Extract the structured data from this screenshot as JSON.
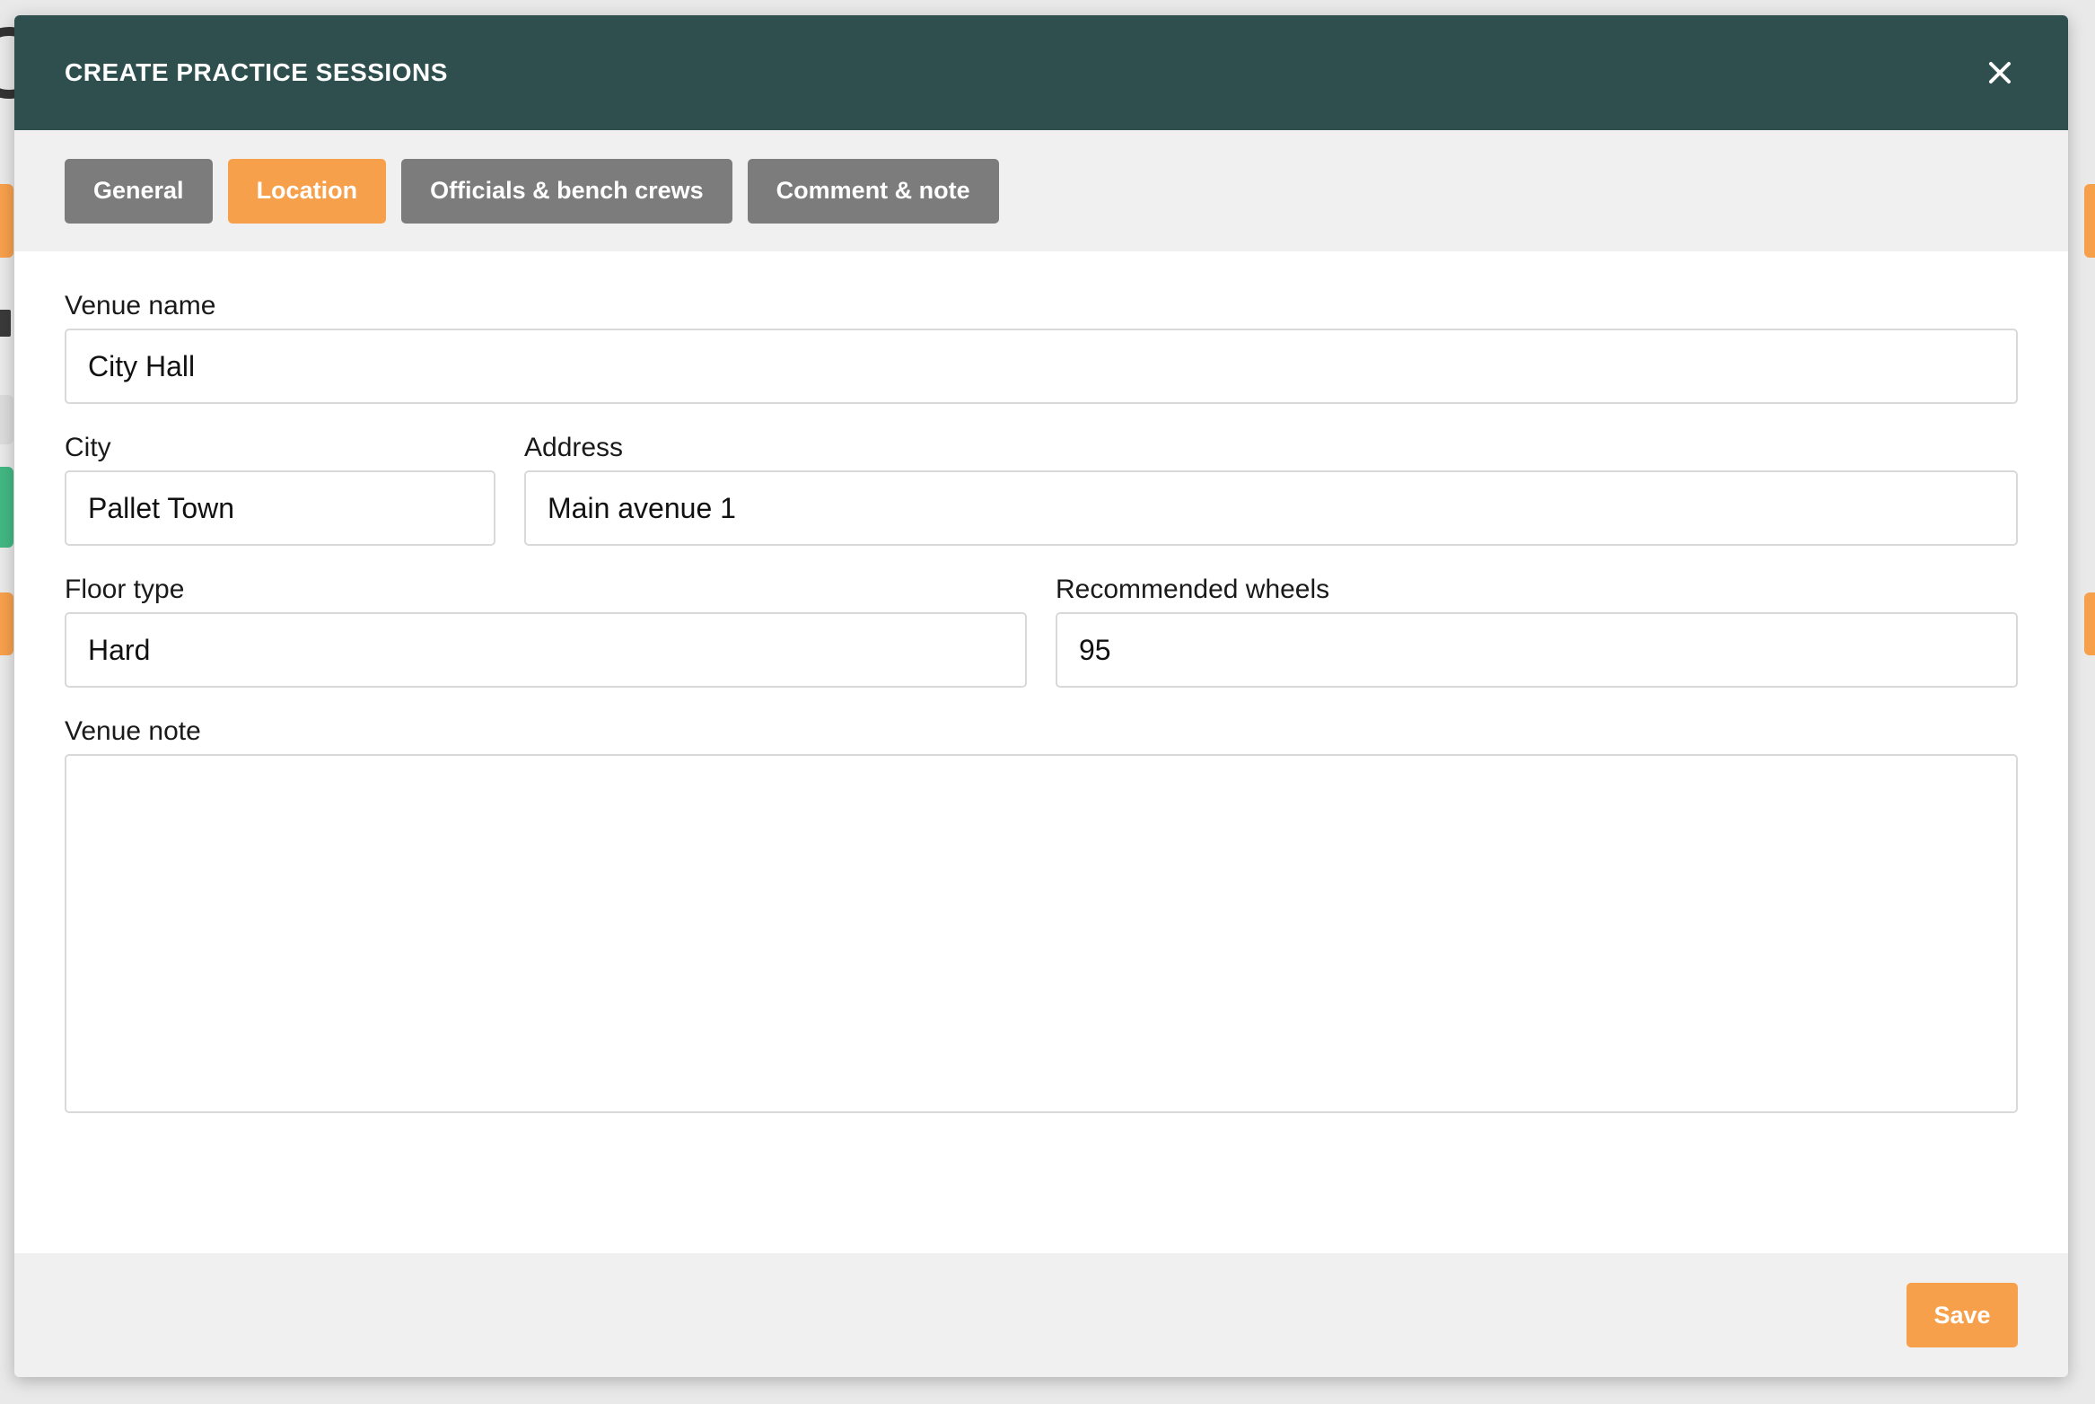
{
  "modal": {
    "title": "CREATE PRACTICE SESSIONS",
    "close_icon": "close-icon"
  },
  "tabs": [
    {
      "label": "General",
      "active": false
    },
    {
      "label": "Location",
      "active": true
    },
    {
      "label": "Officials & bench crews",
      "active": false
    },
    {
      "label": "Comment & note",
      "active": false
    }
  ],
  "form": {
    "venue_name": {
      "label": "Venue name",
      "value": "City Hall"
    },
    "city": {
      "label": "City",
      "value": "Pallet Town"
    },
    "address": {
      "label": "Address",
      "value": "Main avenue 1"
    },
    "floor_type": {
      "label": "Floor type",
      "value": "Hard"
    },
    "recommended_wheels": {
      "label": "Recommended wheels",
      "value": "95"
    },
    "venue_note": {
      "label": "Venue note",
      "value": ""
    }
  },
  "footer": {
    "save_label": "Save"
  },
  "colors": {
    "header_bg": "#2f4f4f",
    "accent": "#f7a04c",
    "tab_inactive": "#7c7c7c"
  }
}
